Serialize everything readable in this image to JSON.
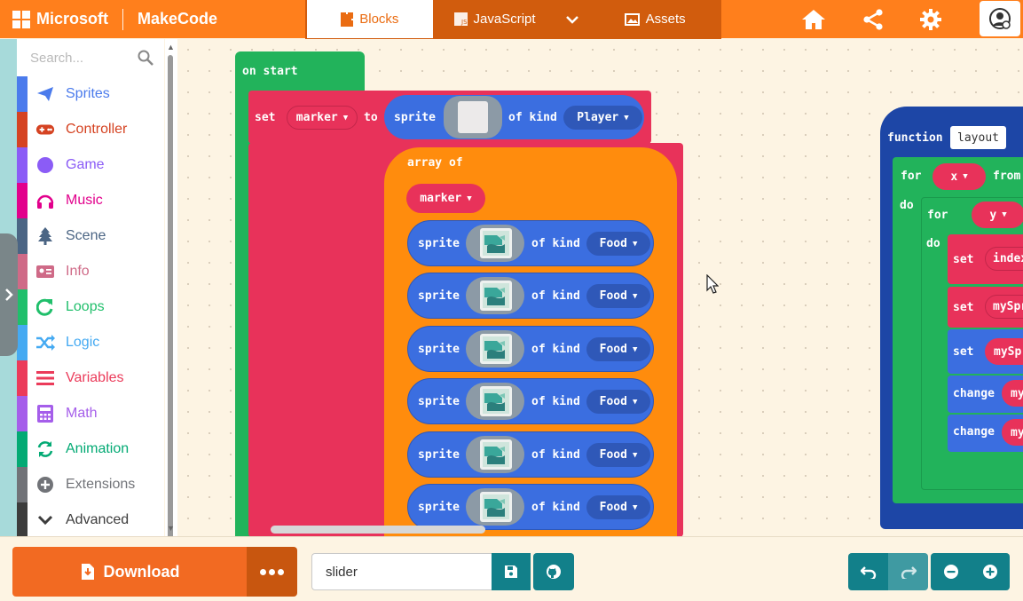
{
  "header": {
    "brand_ms": "Microsoft",
    "brand_makecode": "MakeCode",
    "tabs": [
      {
        "label": "Blocks",
        "active": true
      },
      {
        "label": "JavaScript",
        "active": false
      },
      {
        "label": "Assets",
        "active": false
      }
    ],
    "icons": [
      "home-icon",
      "share-icon",
      "settings-icon",
      "user-icon"
    ]
  },
  "toolbox": {
    "search_placeholder": "Search...",
    "categories": [
      {
        "label": "Sprites",
        "color": "#4b7bec",
        "icon": "paper-plane-icon"
      },
      {
        "label": "Controller",
        "color": "#d54322",
        "icon": "gamepad-icon"
      },
      {
        "label": "Game",
        "color": "#8b5cf6",
        "icon": "circle-icon"
      },
      {
        "label": "Music",
        "color": "#e2008c",
        "icon": "headphones-icon"
      },
      {
        "label": "Scene",
        "color": "#4b6584",
        "icon": "tree-icon"
      },
      {
        "label": "Info",
        "color": "#cf6a87",
        "icon": "id-card-icon"
      },
      {
        "label": "Loops",
        "color": "#20bf6b",
        "icon": "loop-icon"
      },
      {
        "label": "Logic",
        "color": "#45aaf2",
        "icon": "shuffle-icon"
      },
      {
        "label": "Variables",
        "color": "#eb3b5a",
        "icon": "list-icon"
      },
      {
        "label": "Math",
        "color": "#a55eea",
        "icon": "calculator-icon"
      },
      {
        "label": "Animation",
        "color": "#03aa74",
        "icon": "refresh-icon"
      },
      {
        "label": "Extensions",
        "color": "#717378",
        "icon": "plus-circle-icon"
      },
      {
        "label": "Advanced",
        "color": "#3c3c3c",
        "icon": "chevron-down-icon"
      }
    ]
  },
  "workspace": {
    "on_start": "on start",
    "set": "set",
    "marker_var": "marker",
    "to": "to",
    "sprite": "sprite",
    "of_kind": "of kind",
    "player_kind": "Player",
    "array_of": "array of",
    "array_items": [
      {
        "kind": "Food"
      },
      {
        "kind": "Food"
      },
      {
        "kind": "Food"
      },
      {
        "kind": "Food"
      },
      {
        "kind": "Food"
      },
      {
        "kind": "Food"
      }
    ],
    "function_kw": "function",
    "function_name": "layout",
    "for": "for",
    "from": "from",
    "do": "do",
    "x_var": "x",
    "y_var": "y",
    "change": "change",
    "partial_vars": {
      "index": "index",
      "mySpr": "mySpr",
      "mySp": "mySp",
      "my": "my"
    }
  },
  "bottom": {
    "download_label": "Download",
    "project_name": "slider"
  }
}
